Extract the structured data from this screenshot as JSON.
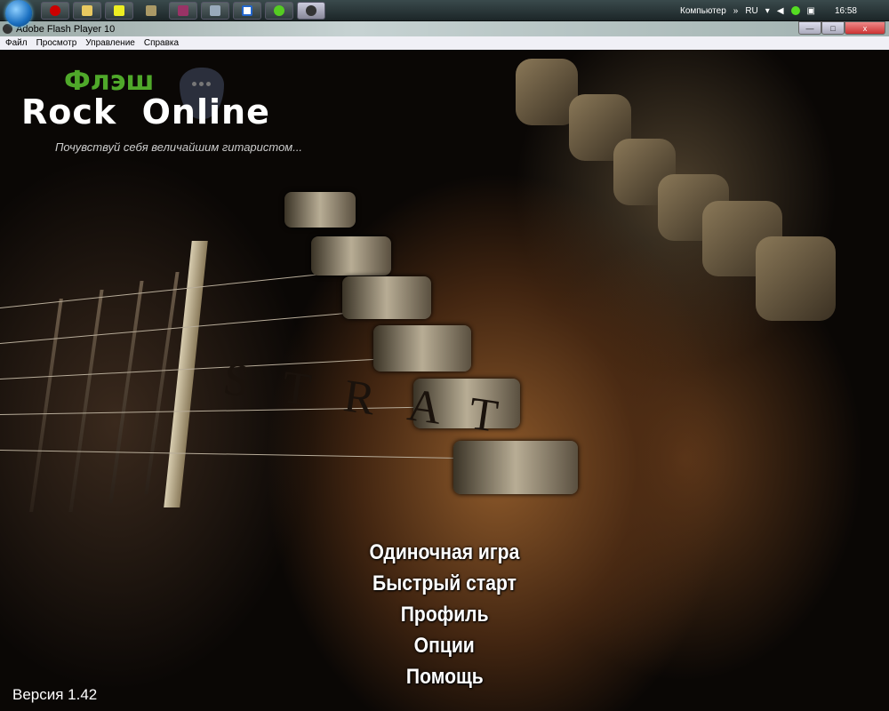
{
  "taskbar": {
    "apps": [
      "opera",
      "explorer",
      "app-yellow",
      "app-game",
      "winrar",
      "monitor",
      "word",
      "icq",
      "flash-player"
    ],
    "tray": {
      "toolbar_label": "Компьютер",
      "chevron": "»",
      "language": "RU",
      "clock": "16:58"
    }
  },
  "window": {
    "title": "Adobe Flash Player 10",
    "minimize": "—",
    "maximize": "□",
    "close": "x"
  },
  "menubar": [
    "Файл",
    "Просмотр",
    "Управление",
    "Справка"
  ],
  "game": {
    "logo_top": "Флэш",
    "logo_main": "Rock  Online",
    "tagline": "Почувствуй себя величайшим гитаристом...",
    "headstock_text": "STRAT",
    "menu": [
      "Одиночная игра",
      "Быстрый старт",
      "Профиль",
      "Опции",
      "Помощь"
    ],
    "version": "Версия 1.42"
  }
}
